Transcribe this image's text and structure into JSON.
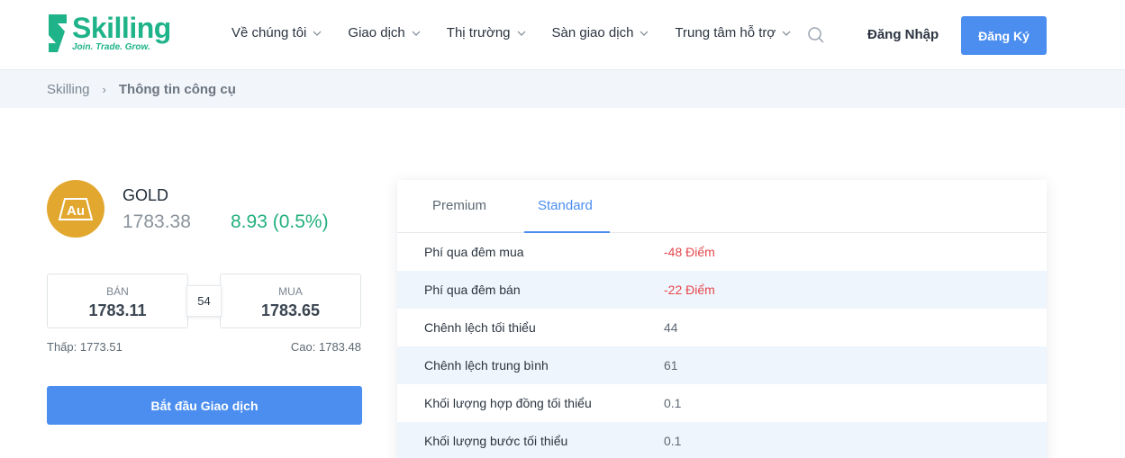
{
  "header": {
    "logo": {
      "name": "Skilling",
      "tagline": "Join. Trade. Grow."
    },
    "nav": [
      {
        "label": "Về chúng tôi"
      },
      {
        "label": "Giao dịch"
      },
      {
        "label": "Thị trường"
      },
      {
        "label": "Sàn giao dịch"
      },
      {
        "label": "Trung tâm hỗ trợ"
      }
    ],
    "login_label": "Đăng Nhập",
    "signup_label": "Đăng Ký"
  },
  "breadcrumb": {
    "home": "Skilling",
    "separator": "›",
    "current": "Thông tin công cụ"
  },
  "instrument": {
    "logo_text": "Au",
    "name": "GOLD",
    "price": "1783.38",
    "change": "8.93 (0.5%)",
    "sell": {
      "label": "BÁN",
      "value": "1783.11"
    },
    "buy": {
      "label": "MUA",
      "value": "1783.65"
    },
    "spread": "54",
    "low": "Thấp: 1773.51",
    "high": "Cao: 1783.48",
    "trade_button": "Bắt đầu Giao dịch"
  },
  "details": {
    "tabs": [
      {
        "label": "Premium",
        "active": false
      },
      {
        "label": "Standard",
        "active": true
      }
    ],
    "rows": [
      {
        "label": "Phí qua đêm mua",
        "value": "-48 Điểm",
        "negative": true
      },
      {
        "label": "Phí qua đêm bán",
        "value": "-22 Điểm",
        "negative": true
      },
      {
        "label": "Chênh lệch tối thiểu",
        "value": "44",
        "negative": false
      },
      {
        "label": "Chênh lệch trung bình",
        "value": "61",
        "negative": false
      },
      {
        "label": "Khối lượng hợp đồng tối thiểu",
        "value": "0.1",
        "negative": false
      },
      {
        "label": "Khối lượng bước tối thiểu",
        "value": "0.1",
        "negative": false
      }
    ]
  },
  "colors": {
    "brand_green": "#1fb389",
    "accent_blue": "#4b8ef0",
    "gold": "#e2a72e",
    "positive": "#23b07d",
    "negative": "#e5484d"
  },
  "icons": {
    "search": "search-icon",
    "chevron": "chevron-down-icon"
  }
}
